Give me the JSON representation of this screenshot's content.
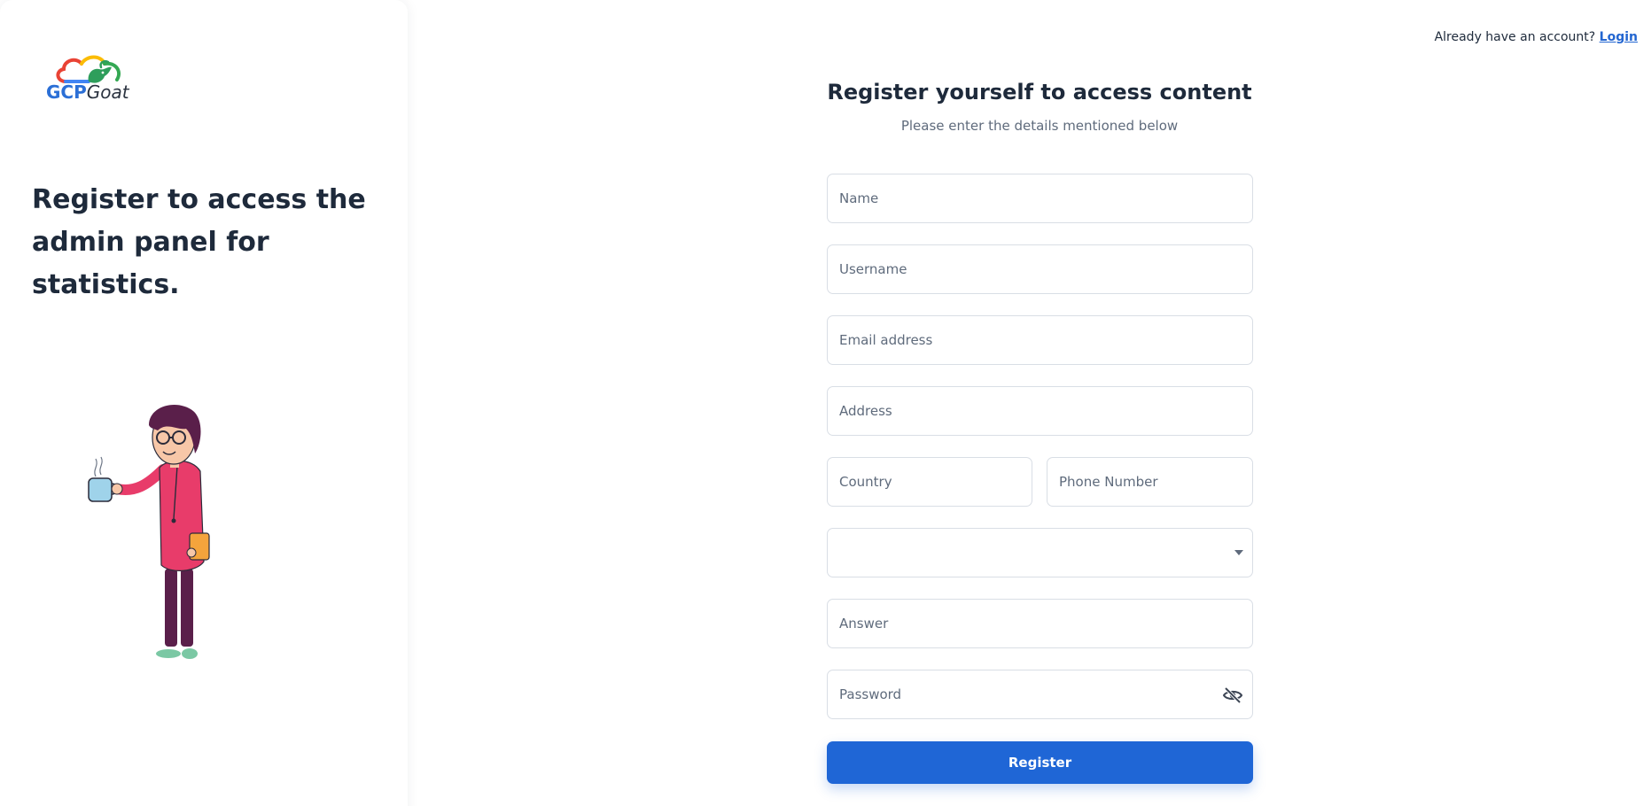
{
  "brand": {
    "logo_text_primary": "GCP",
    "logo_text_secondary": "Goat"
  },
  "side_panel": {
    "heading": "Register to access the admin panel for statistics."
  },
  "header": {
    "prompt": "Already have an account?",
    "login_link": "Login"
  },
  "form": {
    "title": "Register yourself to access content",
    "subtitle": "Please enter the details mentioned below",
    "fields": {
      "name": {
        "placeholder": "Name",
        "value": ""
      },
      "username": {
        "placeholder": "Username",
        "value": ""
      },
      "email": {
        "placeholder": "Email address",
        "value": ""
      },
      "address": {
        "placeholder": "Address",
        "value": ""
      },
      "country": {
        "placeholder": "Country",
        "value": ""
      },
      "phone": {
        "placeholder": "Phone Number",
        "value": ""
      },
      "security_question": {
        "selected": ""
      },
      "answer": {
        "placeholder": "Answer",
        "value": ""
      },
      "password": {
        "placeholder": "Password",
        "value": ""
      }
    },
    "submit_label": "Register"
  },
  "icons": {
    "password_toggle": "eye-slash-icon",
    "select_caret": "caret-down-icon"
  },
  "colors": {
    "primary": "#1f66d6",
    "link": "#2366d1",
    "text_dark": "#1e2a3b",
    "text_muted": "#5f6b7c",
    "border": "#d9dee5"
  }
}
